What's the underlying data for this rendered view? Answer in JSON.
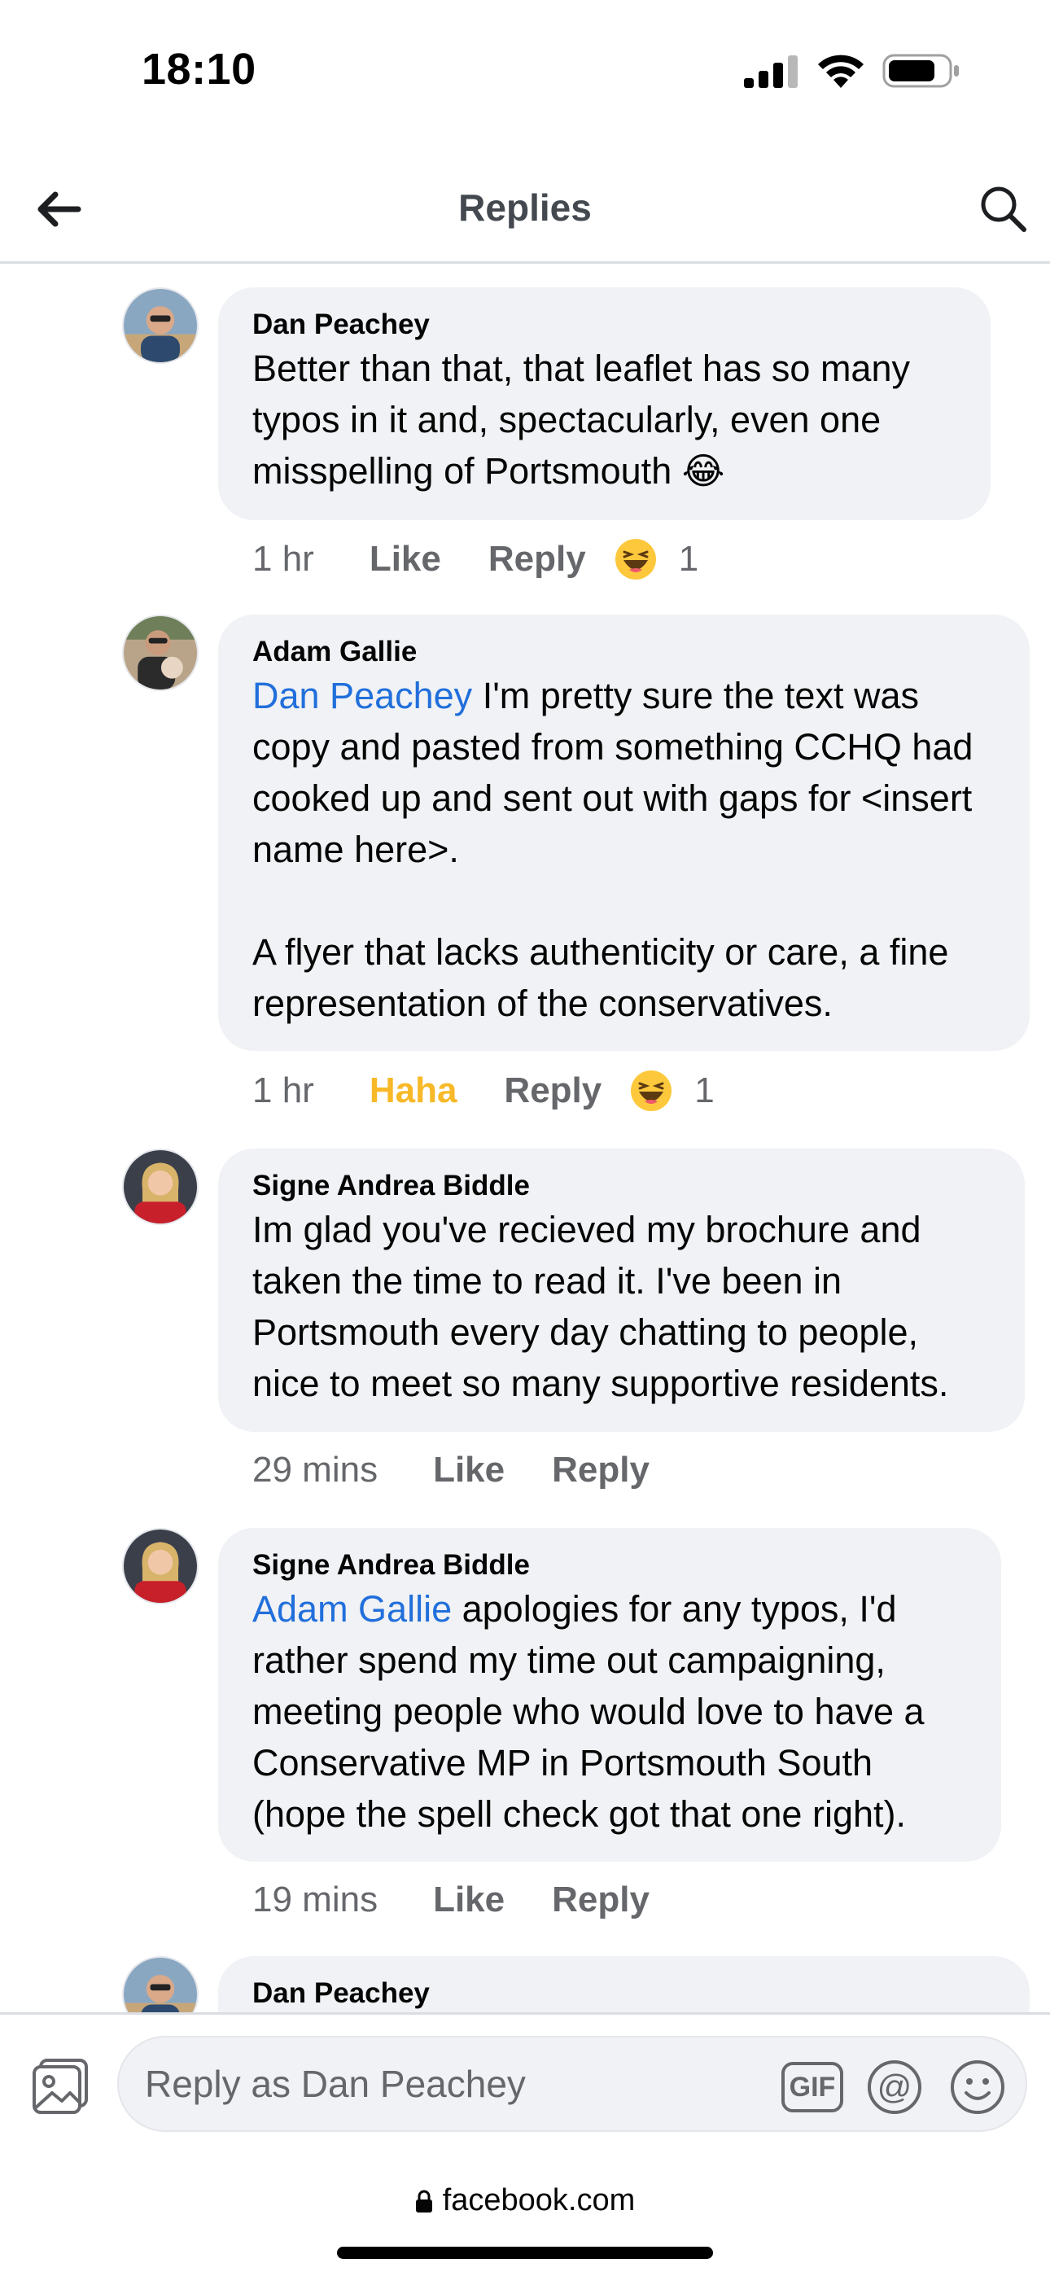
{
  "status_bar": {
    "time": "18:10"
  },
  "header": {
    "title": "Replies"
  },
  "comments": [
    {
      "author": "Dan Peachey",
      "mention": "",
      "text": "Better than that, that leaflet has so many typos in it and, spectacularly, even one misspelling of Portsmouth 😂",
      "time": "1 hr",
      "like_label": "Like",
      "reply_label": "Reply",
      "reaction_icon": "haha-emoji",
      "reaction_count": "1"
    },
    {
      "author": "Adam Gallie",
      "mention": "Dan Peachey",
      "text": " I'm pretty sure the text was copy and pasted from something CCHQ had cooked up and sent out with gaps for <insert name here>.\n\nA flyer that lacks authenticity or care, a fine representation of the conservatives.",
      "time": "1 hr",
      "like_label": "Haha",
      "reply_label": "Reply",
      "reaction_icon": "haha-emoji",
      "reaction_count": "1"
    },
    {
      "author": "Signe Andrea Biddle",
      "mention": "",
      "text": "Im glad you've recieved my brochure and taken the time to read it. I've been in Portsmouth every day chatting to people, nice to meet so many supportive residents.",
      "time": "29 mins",
      "like_label": "Like",
      "reply_label": "Reply"
    },
    {
      "author": "Signe Andrea Biddle",
      "mention": "Adam Gallie",
      "text": " apologies for any typos, I'd rather spend my time out campaigning, meeting people who would love to have a Conservative MP in Portsmouth South (hope the spell check got that one right).",
      "time": "19 mins",
      "like_label": "Like",
      "reply_label": "Reply"
    },
    {
      "author": "Dan Peachey"
    }
  ],
  "composer": {
    "placeholder": "Reply as Dan Peachey",
    "gif_label": "GIF"
  },
  "browser": {
    "url": "facebook.com"
  },
  "colors": {
    "mention": "#216fdb",
    "haha_active": "#f7b928",
    "bubble": "#f0f2f5",
    "secondary_text": "#65676b"
  }
}
